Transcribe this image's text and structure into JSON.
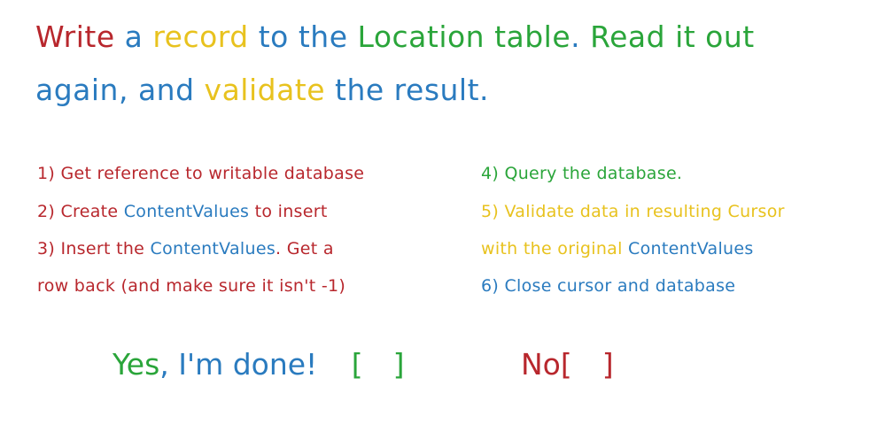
{
  "title": {
    "line1": [
      {
        "text": "Write",
        "color": "#b8272d"
      },
      {
        "text": " a ",
        "color": "#2a7bbf"
      },
      {
        "text": "record",
        "color": "#e8c21e"
      },
      {
        "text": " to the ",
        "color": "#2a7bbf"
      },
      {
        "text": "Location table",
        "color": "#2aa53a"
      },
      {
        "text": ". ",
        "color": "#2a7bbf"
      },
      {
        "text": "Read it out",
        "color": "#2aa53a"
      }
    ],
    "line2": [
      {
        "text": "again",
        "color": "#2a7bbf"
      },
      {
        "text": ", and ",
        "color": "#2a7bbf"
      },
      {
        "text": "validate",
        "color": "#e8c21e"
      },
      {
        "text": " the result.",
        "color": "#2a7bbf"
      }
    ]
  },
  "steps": {
    "s1": [
      {
        "text": "1) Get reference to writable database",
        "color": "#b8272d"
      }
    ],
    "s2": [
      {
        "text": "2) Create ",
        "color": "#b8272d"
      },
      {
        "text": "ContentValues",
        "color": "#2a7bbf"
      },
      {
        "text": " to insert",
        "color": "#b8272d"
      }
    ],
    "s3a": [
      {
        "text": "3) Insert the ",
        "color": "#b8272d"
      },
      {
        "text": "ContentValues",
        "color": "#2a7bbf"
      },
      {
        "text": ". Get a",
        "color": "#b8272d"
      }
    ],
    "s3b": [
      {
        "text": "row back (and make sure it isn't -1)",
        "color": "#b8272d"
      }
    ],
    "s4": [
      {
        "text": "4) Query the database.",
        "color": "#2aa53a"
      }
    ],
    "s5a": [
      {
        "text": "5) Validate data in resulting Cursor",
        "color": "#e8c21e"
      }
    ],
    "s5b": [
      {
        "text": "with the original ",
        "color": "#e8c21e"
      },
      {
        "text": "ContentValues",
        "color": "#2a7bbf"
      }
    ],
    "s6": [
      {
        "text": "6) Close cursor and database",
        "color": "#2a7bbf"
      }
    ]
  },
  "answers": {
    "yes_label_1": "Yes",
    "yes_label_2": ", I'm done!",
    "yes_open": "[",
    "yes_close": "]",
    "no_label": "No",
    "no_open": "[",
    "no_close": "]"
  },
  "colors": {
    "red": "#b8272d",
    "yellow": "#e8c21e",
    "blue": "#2a7bbf",
    "green": "#2aa53a"
  }
}
